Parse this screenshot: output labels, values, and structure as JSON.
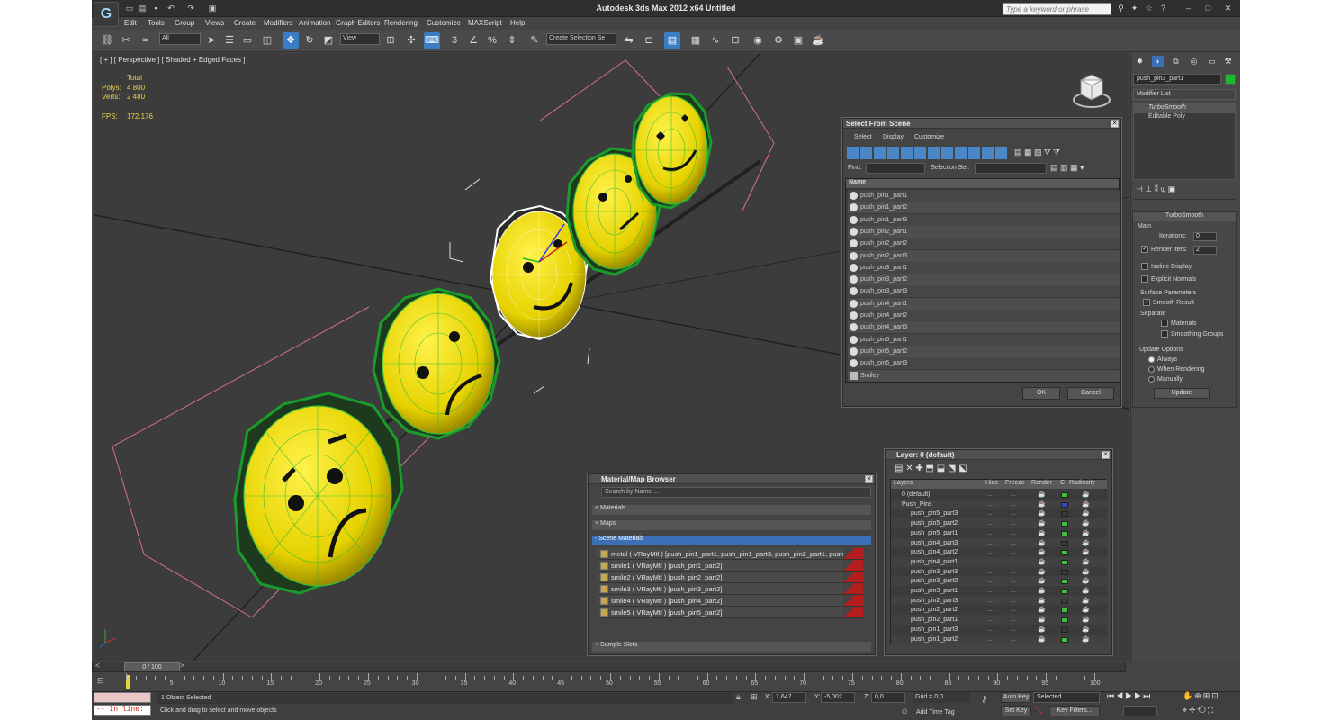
{
  "app": {
    "logo": "G",
    "title": "Autodesk 3ds Max  2012 x64     Untitled",
    "search_placeholder": "Type a keyword or phrase"
  },
  "menus": [
    "Edit",
    "Tools",
    "Group",
    "Views",
    "Create",
    "Modifiers",
    "Animation",
    "Graph Editors",
    "Rendering",
    "Customize",
    "MAXScript",
    "Help"
  ],
  "toolbar": {
    "selection_filter": "All",
    "ref_coord": "View",
    "snaps_label": "3",
    "percent_snap": "%",
    "named_selection_placeholder": "Create Selection Se"
  },
  "viewport": {
    "label": "[ + ] [ Perspective ] [ Shaded + Edged Faces ]",
    "stats": {
      "total_label": "Total",
      "polys_label": "Polys:",
      "polys_value": "4 800",
      "verts_label": "Verts:",
      "verts_value": "2 480",
      "fps_label": "FPS:",
      "fps_value": "172.176"
    }
  },
  "select_from_scene": {
    "title": "Select From Scene",
    "tabs": [
      "Select",
      "Display",
      "Customize"
    ],
    "find_label": "Find:",
    "selection_set_label": "Selection Set:",
    "column_header": "Name",
    "items": [
      "push_pin1_part1",
      "push_pin1_part2",
      "push_pin1_part3",
      "push_pin2_part1",
      "push_pin2_part2",
      "push_pin2_part3",
      "push_pin3_part1",
      "push_pin3_part2",
      "push_pin3_part3",
      "push_pin4_part1",
      "push_pin4_part2",
      "push_pin4_part3",
      "push_pin5_part1",
      "push_pin5_part2",
      "push_pin5_part3",
      "Smiley"
    ],
    "ok_label": "OK",
    "cancel_label": "Cancel"
  },
  "material_browser": {
    "title": "Material/Map Browser",
    "search_placeholder": "Search by Name ...",
    "sections": [
      "+ Materials",
      "+ Maps",
      "- Scene Materials",
      "+ Sample Slots"
    ],
    "materials": [
      "metal  ( VRayMtl ) [push_pin1_part1, push_pin1_part3, push_pin2_part1, push_",
      "smile1  ( VRayMtl ) [push_pin1_part2]",
      "smile2  ( VRayMtl ) [push_pin2_part2]",
      "smile3  ( VRayMtl ) [push_pin3_part2]",
      "smile4  ( VRayMtl ) [push_pin4_part2]",
      "smile5  ( VRayMtl ) [push_pin5_part2]"
    ]
  },
  "layer_dialog": {
    "title": "Layer: 0 (default)",
    "headers": [
      "Layers",
      "Hide",
      "Freeze",
      "Render",
      "C",
      "Radiosity"
    ],
    "layers": [
      {
        "name": "0 (default)",
        "color": "#3fbf3f"
      },
      {
        "name": "Push_Pins",
        "color": "#2f4fbf"
      },
      {
        "name": "push_pin5_part3",
        "color": "#3a3a3a"
      },
      {
        "name": "push_pin5_part2",
        "color": "#3fbf3f"
      },
      {
        "name": "push_pin5_part1",
        "color": "#3fbf3f"
      },
      {
        "name": "push_pin4_part3",
        "color": "#3a3a3a"
      },
      {
        "name": "push_pin4_part2",
        "color": "#3fbf3f"
      },
      {
        "name": "push_pin4_part1",
        "color": "#3fbf3f"
      },
      {
        "name": "push_pin3_part3",
        "color": "#3a3a3a"
      },
      {
        "name": "push_pin3_part2",
        "color": "#3fbf3f"
      },
      {
        "name": "push_pin3_part1",
        "color": "#3fbf3f"
      },
      {
        "name": "push_pin2_part3",
        "color": "#3a3a3a"
      },
      {
        "name": "push_pin2_part2",
        "color": "#3fbf3f"
      },
      {
        "name": "push_pin2_part1",
        "color": "#3fbf3f"
      },
      {
        "name": "push_pin1_part3",
        "color": "#3a3a3a"
      },
      {
        "name": "push_pin1_part2",
        "color": "#3fbf3f"
      }
    ]
  },
  "command_panel": {
    "object_name": "push_pin3_part1",
    "modifier_list": "Modifier List",
    "stack": [
      "TurboSmooth",
      "Editable Poly"
    ],
    "turbosmooth": {
      "title": "TurboSmooth",
      "main": "Main",
      "iterations_label": "Iterations:",
      "iterations_value": "0",
      "render_iters_label": "Render Iters:",
      "render_iters_value": "2",
      "isoline": "Isoline Display",
      "explicit_normals": "Explicit Normals",
      "surface_params": "Surface Parameters",
      "smooth_result": "Smooth Result",
      "separate": "Separate",
      "materials": "Materials",
      "smoothing_groups": "Smoothing Groups",
      "update_options": "Update Options",
      "always": "Always",
      "when_rendering": "When Rendering",
      "manually": "Manually",
      "update": "Update"
    }
  },
  "timeline": {
    "frame": "0 / 100",
    "ticks": [
      "0",
      "5",
      "10",
      "15",
      "20",
      "25",
      "30",
      "35",
      "40",
      "45",
      "50",
      "55",
      "60",
      "65",
      "70",
      "75",
      "80",
      "85",
      "90",
      "95",
      "100"
    ]
  },
  "status": {
    "maxscript_listener": "-- In line:",
    "selected": "1 Object Selected",
    "prompt": "Click and drag to select and move objects",
    "x_label": "X:",
    "x_value": "1,647",
    "y_label": "Y:",
    "y_value": "-5,002",
    "z_label": "Z:",
    "z_value": "0,0",
    "grid": "Grid = 0,0",
    "add_time_tag": "Add Time Tag",
    "auto_key": "Auto Key",
    "set_key": "Set Key",
    "key_mode": "Selected",
    "key_filters": "Key Filters..."
  }
}
